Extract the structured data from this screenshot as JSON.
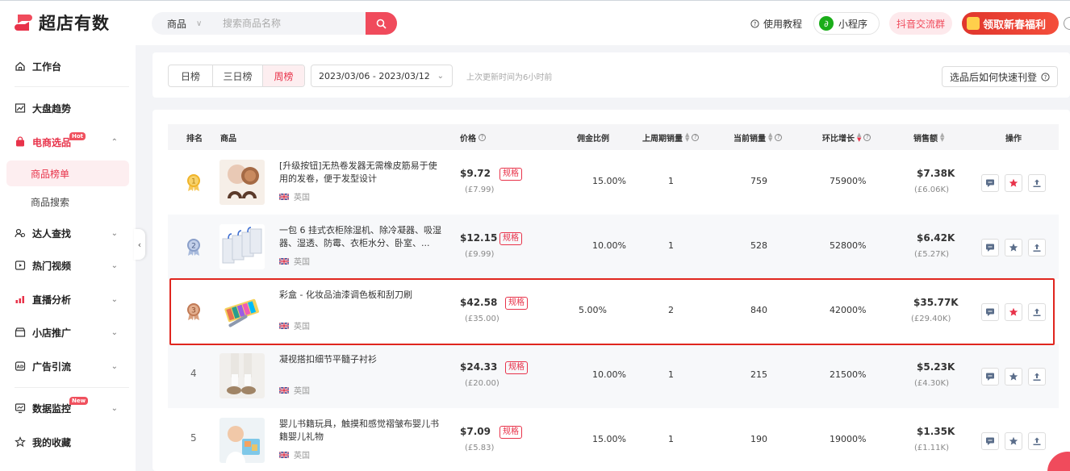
{
  "app": {
    "name": "超店有数"
  },
  "header": {
    "search_category": "商品",
    "search_placeholder": "搜索商品名称",
    "tutorial": "使用教程",
    "mini_program": "小程序",
    "douyin_group": "抖音交流群",
    "promo": "领取新春福利"
  },
  "sidebar": {
    "items": [
      {
        "label": "工作台",
        "icon": "home-icon"
      },
      {
        "label": "大盘趋势",
        "icon": "trend-icon"
      },
      {
        "label": "电商选品",
        "icon": "bag-icon",
        "badge": "Hot"
      },
      {
        "label": "商品榜单"
      },
      {
        "label": "商品搜索"
      },
      {
        "label": "达人查找",
        "icon": "people-icon"
      },
      {
        "label": "热门视频",
        "icon": "video-icon"
      },
      {
        "label": "直播分析",
        "icon": "live-icon"
      },
      {
        "label": "小店推广",
        "icon": "shop-icon"
      },
      {
        "label": "广告引流",
        "icon": "ad-icon"
      },
      {
        "label": "数据监控",
        "icon": "monitor-icon",
        "badge": "New"
      },
      {
        "label": "我的收藏",
        "icon": "star-icon"
      }
    ]
  },
  "filters": {
    "tabs": [
      "日榜",
      "三日榜",
      "周榜"
    ],
    "active_tab": "周榜",
    "date_range": "2023/03/06 - 2023/03/12",
    "updated": "上次更新时间为6小时前",
    "howto": "选品后如何快速刊登"
  },
  "table": {
    "headers": {
      "rank": "排名",
      "product": "商品",
      "price": "价格",
      "commission": "佣金比例",
      "prev_sales": "上周期销量",
      "current_sales": "当前销量",
      "growth": "环比增长",
      "revenue": "销售额",
      "actions": "操作"
    },
    "spec_label": "规格",
    "rows": [
      {
        "rank": "1",
        "name": "[升级按钮]无热卷发器无需橡皮筋易于使用的发卷，便于发型设计",
        "region": "英国",
        "price": "$9.72",
        "price_local": "(£7.99)",
        "commission": "15.00%",
        "prev": "1",
        "current": "759",
        "growth": "75900%",
        "revenue": "$7.38K",
        "revenue_local": "(£6.06K)",
        "starred": true
      },
      {
        "rank": "2",
        "name": "一包 6 挂式衣柜除湿机、除冷凝器、吸湿器、湿透、防霉、衣柜水分、卧室、...",
        "region": "英国",
        "price": "$12.15",
        "price_local": "(£9.99)",
        "commission": "10.00%",
        "prev": "1",
        "current": "528",
        "growth": "52800%",
        "revenue": "$6.42K",
        "revenue_local": "(£5.27K)",
        "starred": false
      },
      {
        "rank": "3",
        "name": "彩盒 - 化妆品油漆调色板和刮刀刷",
        "region": "英国",
        "price": "$42.58",
        "price_local": "(£35.00)",
        "commission": "5.00%",
        "prev": "2",
        "current": "840",
        "growth": "42000%",
        "revenue": "$35.77K",
        "revenue_local": "(£29.40K)",
        "starred": true
      },
      {
        "rank": "4",
        "name": "凝视搭扣细节平髓子衬衫",
        "region": "英国",
        "price": "$24.33",
        "price_local": "(£20.00)",
        "commission": "10.00%",
        "prev": "1",
        "current": "215",
        "growth": "21500%",
        "revenue": "$5.23K",
        "revenue_local": "(£4.30K)",
        "starred": false
      },
      {
        "rank": "5",
        "name": "婴儿书籍玩具，触摸和感觉褶皱布婴儿书籍婴儿礼物",
        "region": "英国",
        "price": "$7.09",
        "price_local": "(£5.83)",
        "commission": "15.00%",
        "prev": "1",
        "current": "190",
        "growth": "19000%",
        "revenue": "$1.35K",
        "revenue_local": "(£1.11K)",
        "starred": false
      }
    ]
  },
  "colors": {
    "accent": "#e8334a",
    "highlight": "#e0261f",
    "gold": "#f0b429",
    "silver": "#8a9fc9",
    "bronze": "#c17a55"
  }
}
